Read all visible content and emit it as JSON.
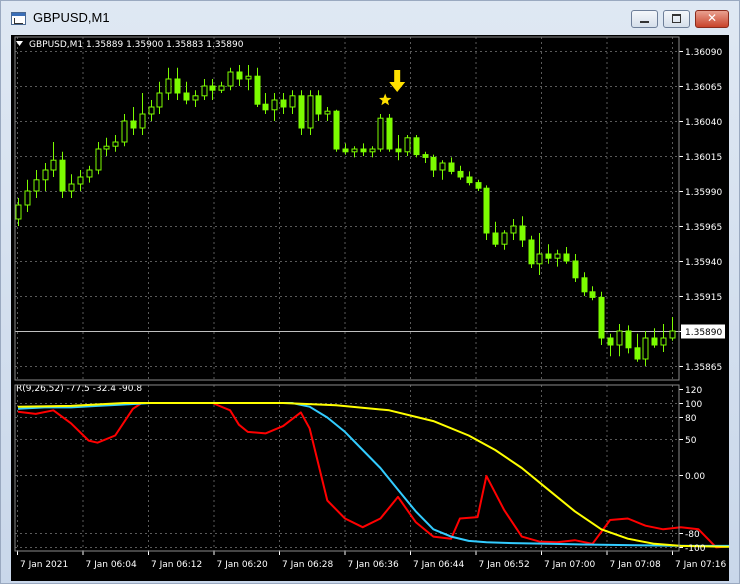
{
  "window": {
    "title": "GBPUSD,M1"
  },
  "chart": {
    "header": "GBPUSD,M1  1.35889 1.35900 1.35883 1.35890",
    "indicator_header": "R(9,26,52) -77.5 -32.4 -90.8"
  },
  "colors": {
    "background": "#000000",
    "grid": "#5a5a5a",
    "candle": "#7cfc00",
    "text": "#ffffff",
    "arrow": "#ffe000",
    "star": "#ffe000",
    "line_fast": "#ff0000",
    "line_mid": "#33ccff",
    "line_slow": "#ffff00"
  },
  "chart_data": [
    {
      "type": "candlestick",
      "symbol": "GBPUSD",
      "timeframe": "M1",
      "price_ticks": [
        "1.36090",
        "1.36065",
        "1.36040",
        "1.36015",
        "1.35990",
        "1.35965",
        "1.35940",
        "1.35915",
        "1.35890",
        "1.35865"
      ],
      "current_price": "1.35890",
      "ylim": [
        1.35855,
        1.361
      ],
      "time_ticks": [
        "7 Jan 2021",
        "7 Jan 06:04",
        "7 Jan 06:12",
        "7 Jan 06:20",
        "7 Jan 06:28",
        "7 Jan 06:36",
        "7 Jan 06:44",
        "7 Jan 06:52",
        "7 Jan 07:00",
        "7 Jan 07:08",
        "7 Jan 07:16"
      ],
      "candles": [
        [
          1.3597,
          1.35985,
          1.35965,
          1.3598
        ],
        [
          1.3598,
          1.35998,
          1.35975,
          1.3599
        ],
        [
          1.3599,
          1.36005,
          1.35985,
          1.35998
        ],
        [
          1.35998,
          1.3601,
          1.3599,
          1.36005
        ],
        [
          1.36005,
          1.36025,
          1.36,
          1.36012
        ],
        [
          1.36012,
          1.36018,
          1.35985,
          1.3599
        ],
        [
          1.3599,
          1.36002,
          1.35985,
          1.35995
        ],
        [
          1.35995,
          1.36005,
          1.3599,
          1.36
        ],
        [
          1.36,
          1.36008,
          1.35996,
          1.36005
        ],
        [
          1.36005,
          1.36025,
          1.36002,
          1.3602
        ],
        [
          1.3602,
          1.36028,
          1.36015,
          1.36022
        ],
        [
          1.36022,
          1.3603,
          1.36018,
          1.36025
        ],
        [
          1.36025,
          1.36045,
          1.36022,
          1.3604
        ],
        [
          1.3604,
          1.3605,
          1.3603,
          1.36035
        ],
        [
          1.36035,
          1.3606,
          1.3603,
          1.36045
        ],
        [
          1.36045,
          1.36055,
          1.3604,
          1.3605
        ],
        [
          1.3605,
          1.36068,
          1.36045,
          1.3606
        ],
        [
          1.3606,
          1.36078,
          1.36055,
          1.3607
        ],
        [
          1.3607,
          1.36078,
          1.36055,
          1.3606
        ],
        [
          1.3606,
          1.36068,
          1.36052,
          1.36055
        ],
        [
          1.36055,
          1.36062,
          1.3605,
          1.36058
        ],
        [
          1.36058,
          1.3607,
          1.36055,
          1.36065
        ],
        [
          1.36065,
          1.3607,
          1.36055,
          1.36062
        ],
        [
          1.36062,
          1.36068,
          1.3606,
          1.36065
        ],
        [
          1.36065,
          1.36078,
          1.36062,
          1.36075
        ],
        [
          1.36075,
          1.3608,
          1.36065,
          1.3607
        ],
        [
          1.3607,
          1.3608,
          1.36062,
          1.36072
        ],
        [
          1.36072,
          1.36078,
          1.3605,
          1.36052
        ],
        [
          1.36052,
          1.3606,
          1.36045,
          1.36048
        ],
        [
          1.36048,
          1.3606,
          1.3604,
          1.36055
        ],
        [
          1.36055,
          1.3606,
          1.36045,
          1.3605
        ],
        [
          1.3605,
          1.36062,
          1.36045,
          1.36058
        ],
        [
          1.36058,
          1.36062,
          1.3603,
          1.36035
        ],
        [
          1.36035,
          1.36062,
          1.3603,
          1.36058
        ],
        [
          1.36058,
          1.36062,
          1.3604,
          1.36045
        ],
        [
          1.36045,
          1.3605,
          1.3604,
          1.36047
        ],
        [
          1.36047,
          1.36048,
          1.36018,
          1.3602
        ],
        [
          1.3602,
          1.36024,
          1.36016,
          1.36018
        ],
        [
          1.36018,
          1.36022,
          1.36014,
          1.3602
        ],
        [
          1.3602,
          1.36024,
          1.36015,
          1.36018
        ],
        [
          1.36018,
          1.36022,
          1.36014,
          1.3602
        ],
        [
          1.3602,
          1.36045,
          1.36018,
          1.36042
        ],
        [
          1.36042,
          1.36045,
          1.36018,
          1.3602
        ],
        [
          1.3602,
          1.3603,
          1.36012,
          1.36018
        ],
        [
          1.36018,
          1.3603,
          1.36015,
          1.36028
        ],
        [
          1.36028,
          1.3603,
          1.36014,
          1.36016
        ],
        [
          1.36016,
          1.36018,
          1.3601,
          1.36014
        ],
        [
          1.36014,
          1.36016,
          1.36,
          1.36005
        ],
        [
          1.36005,
          1.36012,
          1.35998,
          1.3601
        ],
        [
          1.3601,
          1.36014,
          1.36002,
          1.36004
        ],
        [
          1.36004,
          1.36008,
          1.35998,
          1.36
        ],
        [
          1.36,
          1.36004,
          1.35994,
          1.35996
        ],
        [
          1.35996,
          1.35998,
          1.3599,
          1.35992
        ],
        [
          1.35992,
          1.35994,
          1.35955,
          1.3596
        ],
        [
          1.3596,
          1.35968,
          1.3595,
          1.35952
        ],
        [
          1.35952,
          1.35962,
          1.35948,
          1.3596
        ],
        [
          1.3596,
          1.3597,
          1.35955,
          1.35965
        ],
        [
          1.35965,
          1.35972,
          1.3595,
          1.35955
        ],
        [
          1.35955,
          1.35958,
          1.35935,
          1.35938
        ],
        [
          1.35938,
          1.3596,
          1.3593,
          1.35945
        ],
        [
          1.35945,
          1.35952,
          1.35938,
          1.35942
        ],
        [
          1.35942,
          1.35948,
          1.35936,
          1.35945
        ],
        [
          1.35945,
          1.3595,
          1.35938,
          1.3594
        ],
        [
          1.3594,
          1.35945,
          1.35925,
          1.35928
        ],
        [
          1.35928,
          1.35932,
          1.35915,
          1.35918
        ],
        [
          1.35918,
          1.35922,
          1.35912,
          1.35914
        ],
        [
          1.35914,
          1.35918,
          1.3588,
          1.35885
        ],
        [
          1.35885,
          1.35888,
          1.35872,
          1.3588
        ],
        [
          1.3588,
          1.35895,
          1.35872,
          1.3589
        ],
        [
          1.3589,
          1.35894,
          1.35874,
          1.35878
        ],
        [
          1.35878,
          1.35888,
          1.35868,
          1.3587
        ],
        [
          1.3587,
          1.3589,
          1.35865,
          1.35885
        ],
        [
          1.35885,
          1.35892,
          1.35878,
          1.3588
        ],
        [
          1.3588,
          1.35895,
          1.35875,
          1.35885
        ],
        [
          1.35885,
          1.359,
          1.35883,
          1.3589
        ]
      ],
      "signal_marker": {
        "candle_index": 42,
        "shapes": [
          "down-arrow",
          "star"
        ]
      }
    },
    {
      "type": "line",
      "indicator": "R(9,26,52)",
      "readout": [
        "-77.5",
        "-32.4",
        "-90.8"
      ],
      "y_ticks": [
        "120",
        "100",
        "80",
        "50",
        "0.00",
        "-80",
        "-100"
      ],
      "ylim": [
        -105,
        125
      ],
      "x_ticks": [
        "7 Jan 2021",
        "7 Jan 06:04",
        "7 Jan 06:12",
        "7 Jan 06:20",
        "7 Jan 06:28",
        "7 Jan 06:36",
        "7 Jan 06:44",
        "7 Jan 06:52",
        "7 Jan 07:00",
        "7 Jan 07:08",
        "7 Jan 07:16"
      ],
      "series": [
        {
          "color": "#ff0000",
          "values": [
            [
              0,
              88
            ],
            [
              2,
              85
            ],
            [
              4,
              90
            ],
            [
              6,
              72
            ],
            [
              8,
              48
            ],
            [
              9,
              45
            ],
            [
              11,
              55
            ],
            [
              13,
              92
            ],
            [
              14,
              100
            ],
            [
              18,
              100
            ],
            [
              22,
              100
            ],
            [
              24,
              90
            ],
            [
              25,
              70
            ],
            [
              26,
              60
            ],
            [
              28,
              58
            ],
            [
              30,
              68
            ],
            [
              32,
              87
            ],
            [
              33,
              65
            ],
            [
              35,
              -35
            ],
            [
              37,
              -60
            ],
            [
              39,
              -72
            ],
            [
              41,
              -60
            ],
            [
              43,
              -30
            ],
            [
              45,
              -65
            ],
            [
              47,
              -85
            ],
            [
              49,
              -88
            ],
            [
              50,
              -60
            ],
            [
              52,
              -58
            ],
            [
              53,
              -1
            ],
            [
              55,
              -48
            ],
            [
              57,
              -85
            ],
            [
              59,
              -92
            ],
            [
              61,
              -93
            ],
            [
              63,
              -90
            ],
            [
              65,
              -95
            ],
            [
              67,
              -62
            ],
            [
              69,
              -60
            ],
            [
              71,
              -70
            ],
            [
              73,
              -75
            ],
            [
              75,
              -72
            ],
            [
              77,
              -75
            ],
            [
              79,
              -100
            ],
            [
              81,
              -98
            ],
            [
              83,
              -100
            ],
            [
              85,
              -96
            ],
            [
              87,
              -80
            ],
            [
              88,
              -78
            ],
            [
              89,
              -10
            ]
          ]
        },
        {
          "color": "#33ccff",
          "values": [
            [
              0,
              92
            ],
            [
              3,
              94
            ],
            [
              6,
              94
            ],
            [
              9,
              96
            ],
            [
              12,
              98
            ],
            [
              15,
              100
            ],
            [
              25,
              100
            ],
            [
              31,
              100
            ],
            [
              33,
              95
            ],
            [
              35,
              80
            ],
            [
              37,
              60
            ],
            [
              39,
              35
            ],
            [
              41,
              10
            ],
            [
              43,
              -20
            ],
            [
              45,
              -50
            ],
            [
              47,
              -75
            ],
            [
              49,
              -85
            ],
            [
              51,
              -91
            ],
            [
              53,
              -93
            ],
            [
              56,
              -94
            ],
            [
              60,
              -95
            ],
            [
              64,
              -96
            ],
            [
              70,
              -97
            ],
            [
              76,
              -98
            ],
            [
              84,
              -98
            ],
            [
              89,
              -98
            ]
          ]
        },
        {
          "color": "#ffff00",
          "values": [
            [
              0,
              95
            ],
            [
              6,
              96
            ],
            [
              12,
              100
            ],
            [
              20,
              100
            ],
            [
              30,
              100
            ],
            [
              36,
              97
            ],
            [
              42,
              90
            ],
            [
              47,
              75
            ],
            [
              51,
              55
            ],
            [
              54,
              35
            ],
            [
              57,
              10
            ],
            [
              60,
              -20
            ],
            [
              63,
              -50
            ],
            [
              66,
              -75
            ],
            [
              69,
              -88
            ],
            [
              72,
              -95
            ],
            [
              75,
              -98
            ],
            [
              80,
              -99
            ],
            [
              85,
              -99
            ],
            [
              89,
              -97
            ]
          ]
        }
      ]
    }
  ]
}
